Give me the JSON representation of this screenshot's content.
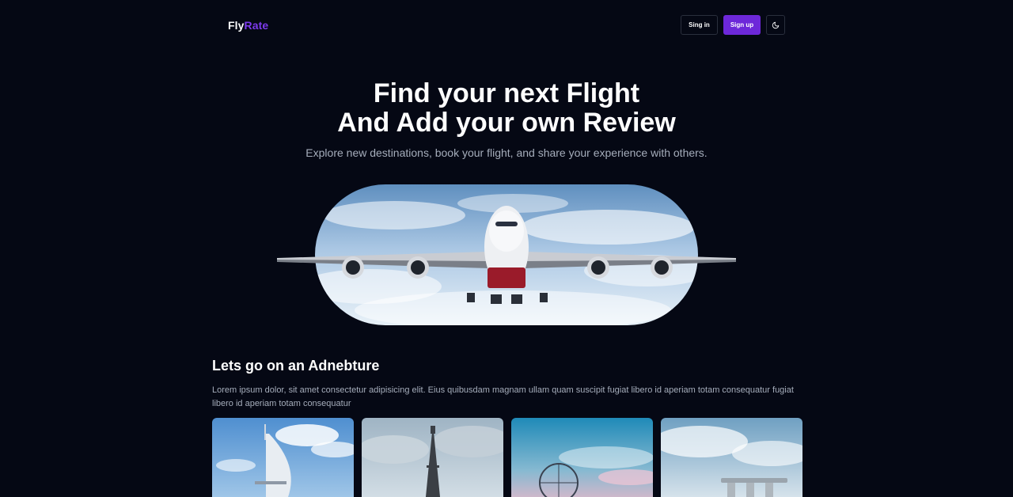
{
  "header": {
    "logo": {
      "part1": "Fly",
      "part2": "Rate"
    },
    "signin_label": "Sing in",
    "signup_label": "Sign up",
    "theme_icon": "moon-icon"
  },
  "hero": {
    "title_line1": "Find your next Flight",
    "title_line2": "And Add your own Review",
    "subtitle": "Explore new destinations, book your flight, and share your experience with others."
  },
  "section": {
    "title": "Lets go on an Adnebture",
    "text": "Lorem ipsum dolor, sit amet consectetur adipisicing elit. Eius quibusdam magnam ullam quam suscipit fugiat libero id aperiam totam consequatur fugiat libero id aperiam totam consequatur"
  },
  "colors": {
    "background": "#050814",
    "accent": "#6d28d9",
    "logo_accent": "#7c3aed",
    "muted_text": "#a5adbb"
  }
}
